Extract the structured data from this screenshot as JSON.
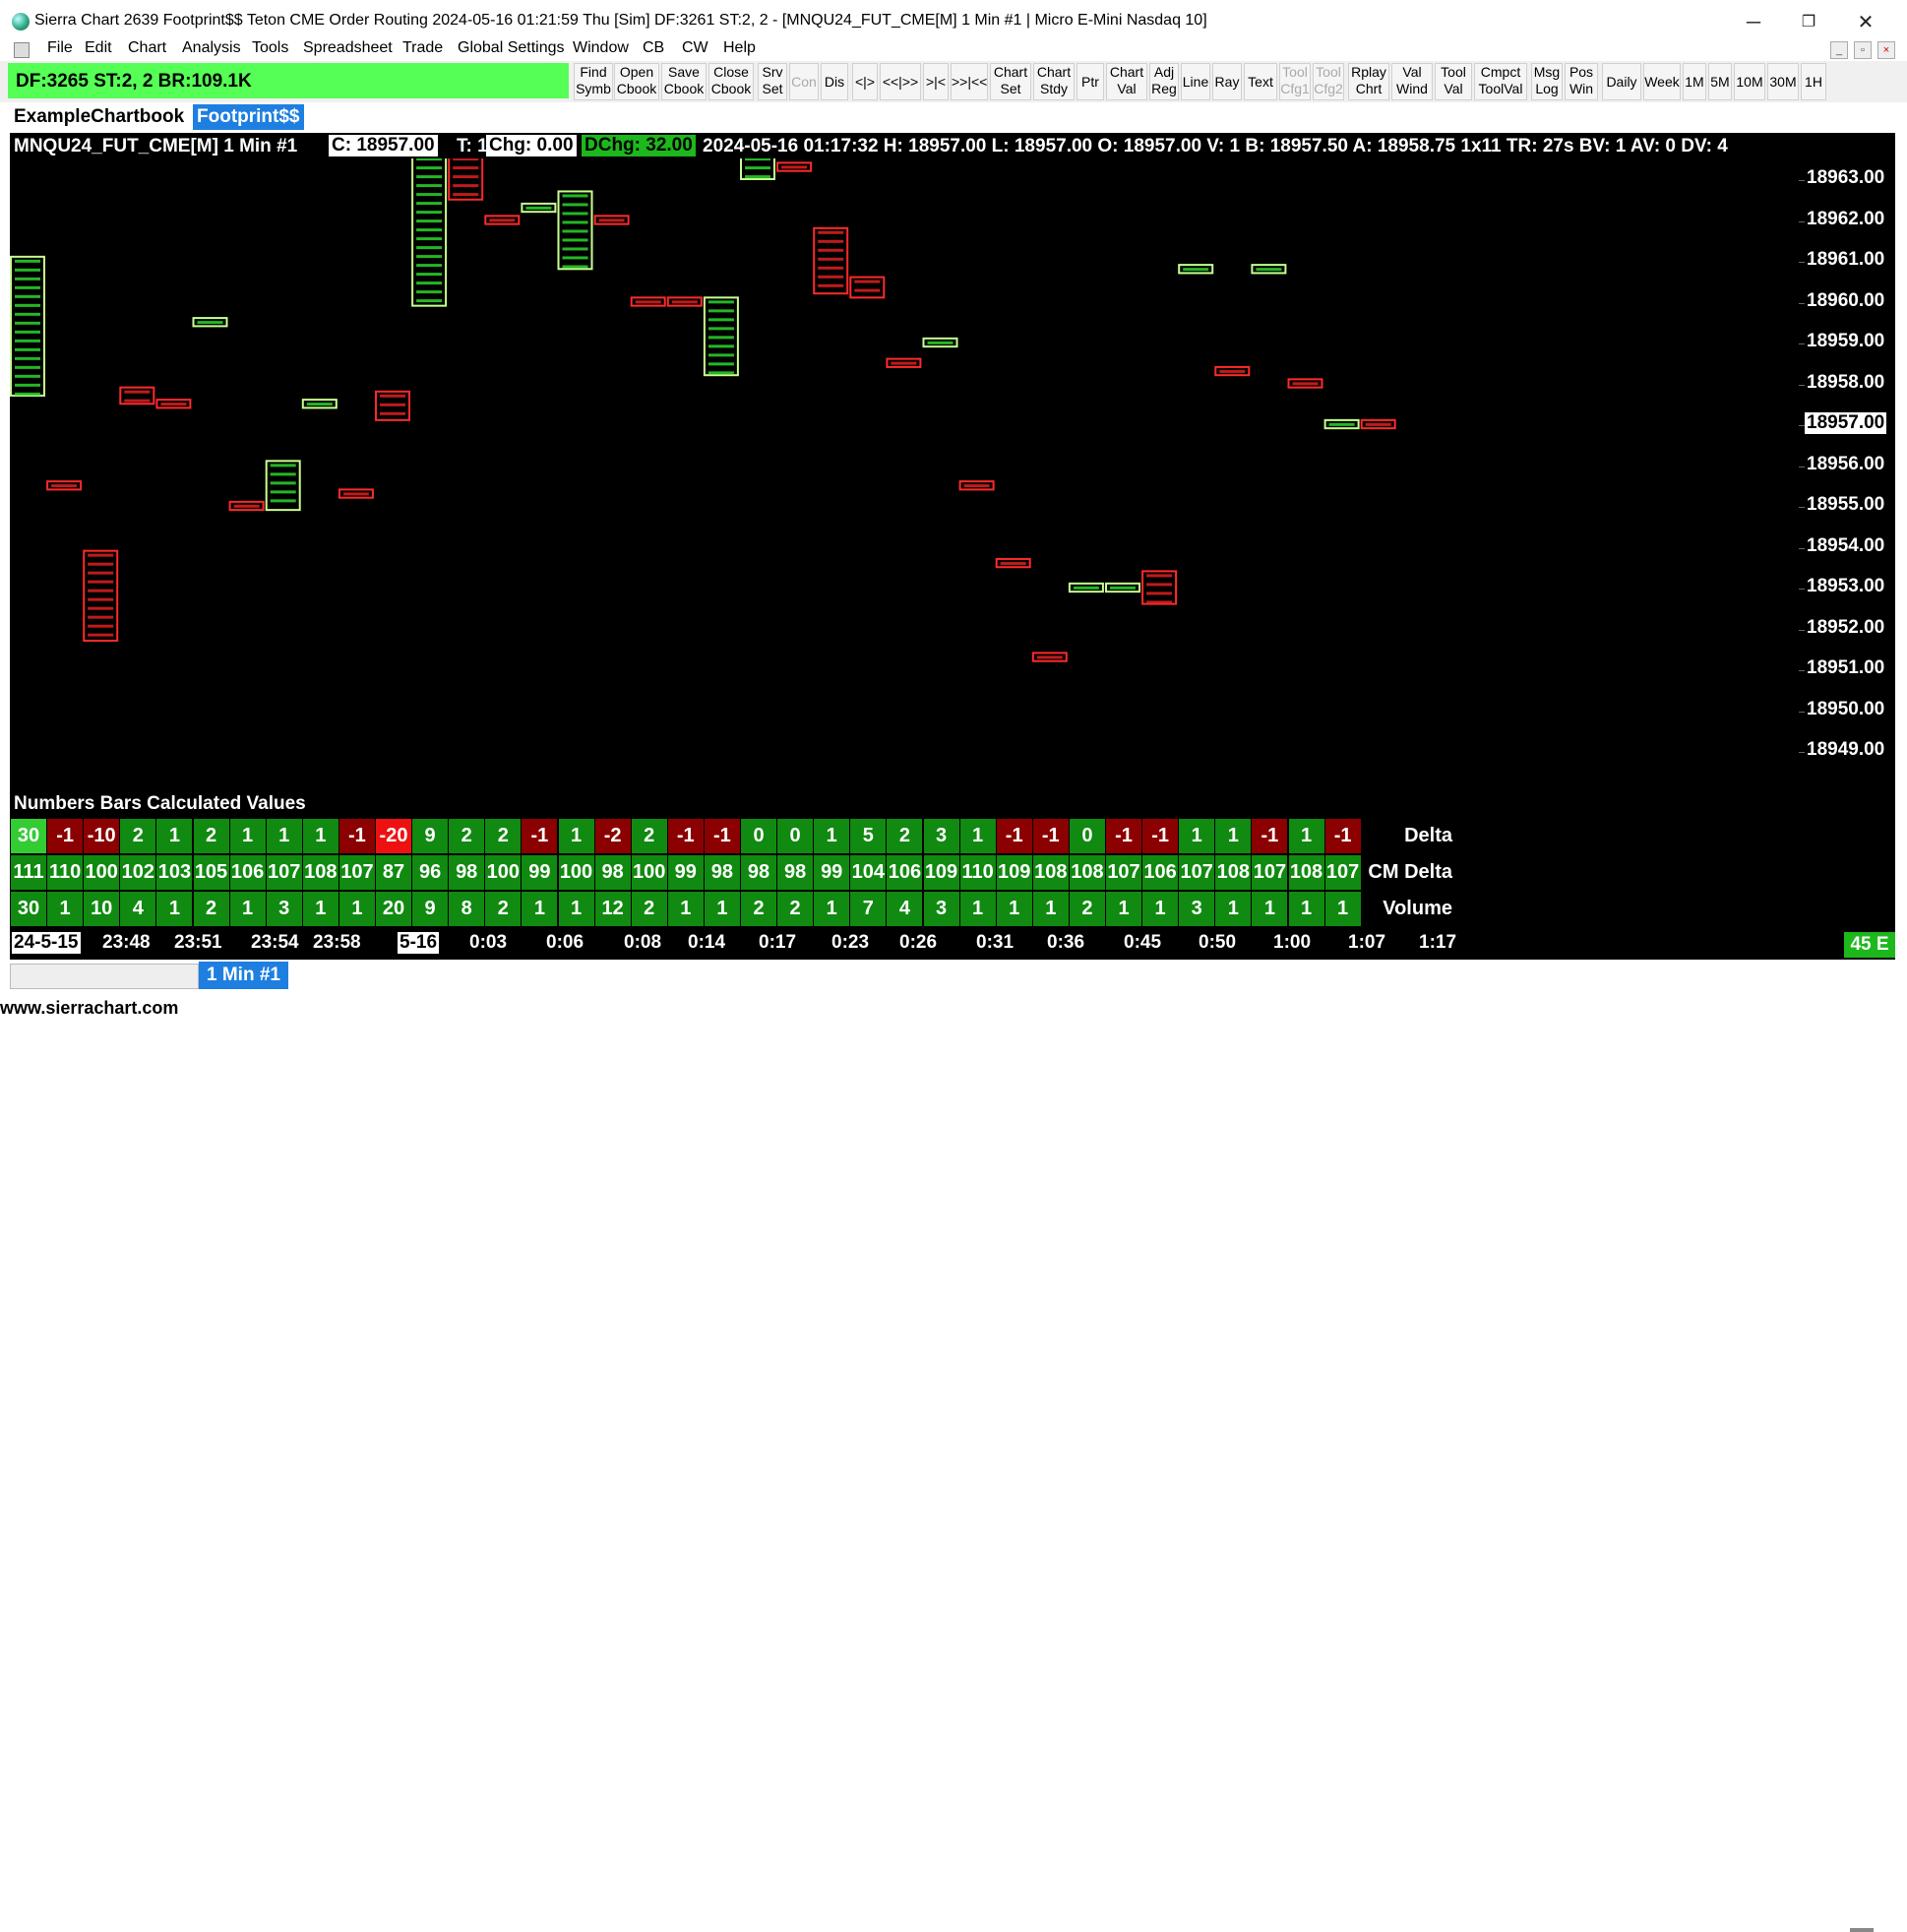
{
  "window": {
    "title": "Sierra Chart 2639 Footprint$$ Teton CME Order Routing 2024-05-16  01:21:59 Thu [Sim] DF:3261  ST:2, 2 - [MNQU24_FUT_CME[M]  1 Min  #1 | Micro E-Mini Nasdaq 10]",
    "minimize": "─",
    "restore": "❐",
    "close": "✕"
  },
  "menu": [
    "File",
    "Edit",
    "Chart",
    "Analysis",
    "Tools",
    "Spreadsheet",
    "Trade",
    "Global Settings",
    "Window",
    "CB",
    "CW",
    "Help"
  ],
  "status": {
    "text": "DF:3265  ST:2, 2  BR:109.1K"
  },
  "toolbar": [
    {
      "l1": "Find",
      "l2": "Symb"
    },
    {
      "l1": "Open",
      "l2": "Cbook"
    },
    {
      "l1": "Save",
      "l2": "Cbook"
    },
    {
      "l1": "Close",
      "l2": "Cbook"
    },
    {
      "l1": "Srv",
      "l2": "Set"
    },
    {
      "l1": "Con",
      "l2": ""
    },
    {
      "l1": "Dis",
      "l2": ""
    },
    {
      "l1": "<|>",
      "l2": ""
    },
    {
      "l1": "<<|>>",
      "l2": ""
    },
    {
      "l1": ">|<",
      "l2": ""
    },
    {
      "l1": ">>|<<",
      "l2": ""
    },
    {
      "l1": "Chart",
      "l2": "Set"
    },
    {
      "l1": "Chart",
      "l2": "Stdy"
    },
    {
      "l1": "Ptr",
      "l2": ""
    },
    {
      "l1": "Chart",
      "l2": "Val"
    },
    {
      "l1": "Adj",
      "l2": "Reg"
    },
    {
      "l1": "Line",
      "l2": ""
    },
    {
      "l1": "Ray",
      "l2": ""
    },
    {
      "l1": "Text",
      "l2": ""
    },
    {
      "l1": "Tool",
      "l2": "Cfg1"
    },
    {
      "l1": "Tool",
      "l2": "Cfg2"
    },
    {
      "l1": "Rplay",
      "l2": "Chrt"
    },
    {
      "l1": "Val",
      "l2": "Wind"
    },
    {
      "l1": "Tool",
      "l2": "Val"
    },
    {
      "l1": "Cmpct",
      "l2": "ToolVal"
    },
    {
      "l1": "Msg",
      "l2": "Log"
    },
    {
      "l1": "Pos",
      "l2": "Win"
    },
    {
      "l1": "Daily",
      "l2": ""
    },
    {
      "l1": "Week",
      "l2": ""
    },
    {
      "l1": "1M",
      "l2": ""
    },
    {
      "l1": "5M",
      "l2": ""
    },
    {
      "l1": "10M",
      "l2": ""
    },
    {
      "l1": "30M",
      "l2": ""
    },
    {
      "l1": "1H",
      "l2": ""
    }
  ],
  "tabs": {
    "chartbook": "ExampleChartbook",
    "active": "Footprint$$"
  },
  "header": {
    "symbol": "MNQU24_FUT_CME[M]  1 Min  #1",
    "close": "C: 18957.00",
    "trades": "T: 1",
    "chg": "Chg: 0.00",
    "dchg": "DChg: 32.00",
    "rest": "2024-05-16 01:17:32 H: 18957.00 L: 18957.00 O: 18957.00 V: 1 B: 18957.50 A: 18958.75 1x11 TR: 27s BV: 1 AV: 0 DV: 4"
  },
  "price_axis": {
    "labels": [
      "18963.00",
      "18962.00",
      "18961.00",
      "18960.00",
      "18959.00",
      "18958.00",
      "18957.00",
      "18956.00",
      "18955.00",
      "18954.00",
      "18953.00",
      "18952.00",
      "18951.00",
      "18950.00",
      "18949.00"
    ],
    "current": "18957.00"
  },
  "chart_data": {
    "type": "candlestick-footprint",
    "bars": [
      {
        "hi": 18961.1,
        "lo": 18957.7,
        "dir": "up"
      },
      {
        "hi": 18955.6,
        "lo": 18955.4,
        "dir": "dn"
      },
      {
        "hi": 18953.9,
        "lo": 18951.7,
        "dir": "dn"
      },
      {
        "hi": 18957.9,
        "lo": 18957.5,
        "dir": "dn"
      },
      {
        "hi": 18957.6,
        "lo": 18957.4,
        "dir": "dn"
      },
      {
        "hi": 18959.6,
        "lo": 18959.4,
        "dir": "up"
      },
      {
        "hi": 18955.1,
        "lo": 18954.9,
        "dir": "dn"
      },
      {
        "hi": 18956.1,
        "lo": 18954.9,
        "dir": "up"
      },
      {
        "hi": 18957.6,
        "lo": 18957.4,
        "dir": "up"
      },
      {
        "hi": 18955.4,
        "lo": 18955.2,
        "dir": "dn"
      },
      {
        "hi": 18957.8,
        "lo": 18957.1,
        "dir": "dn"
      },
      {
        "hi": 18963.6,
        "lo": 18959.9,
        "dir": "up"
      },
      {
        "hi": 18963.6,
        "lo": 18962.5,
        "dir": "dn"
      },
      {
        "hi": 18962.1,
        "lo": 18961.9,
        "dir": "dn"
      },
      {
        "hi": 18962.4,
        "lo": 18962.2,
        "dir": "up"
      },
      {
        "hi": 18962.7,
        "lo": 18960.8,
        "dir": "up"
      },
      {
        "hi": 18962.1,
        "lo": 18961.9,
        "dir": "dn"
      },
      {
        "hi": 18960.1,
        "lo": 18959.9,
        "dir": "dn"
      },
      {
        "hi": 18960.1,
        "lo": 18959.9,
        "dir": "dn"
      },
      {
        "hi": 18960.1,
        "lo": 18958.2,
        "dir": "up"
      },
      {
        "hi": 18963.6,
        "lo": 18963.0,
        "dir": "up"
      },
      {
        "hi": 18963.4,
        "lo": 18963.2,
        "dir": "dn"
      },
      {
        "hi": 18961.8,
        "lo": 18960.2,
        "dir": "dn"
      },
      {
        "hi": 18960.6,
        "lo": 18960.1,
        "dir": "dn"
      },
      {
        "hi": 18958.6,
        "lo": 18958.4,
        "dir": "dn"
      },
      {
        "hi": 18959.1,
        "lo": 18958.9,
        "dir": "up"
      },
      {
        "hi": 18955.6,
        "lo": 18955.4,
        "dir": "dn"
      },
      {
        "hi": 18953.7,
        "lo": 18953.5,
        "dir": "dn"
      },
      {
        "hi": 18951.4,
        "lo": 18951.2,
        "dir": "dn"
      },
      {
        "hi": 18953.1,
        "lo": 18952.9,
        "dir": "up"
      },
      {
        "hi": 18953.1,
        "lo": 18952.9,
        "dir": "up"
      },
      {
        "hi": 18953.4,
        "lo": 18952.6,
        "dir": "dn"
      },
      {
        "hi": 18960.9,
        "lo": 18960.7,
        "dir": "up"
      },
      {
        "hi": 18958.4,
        "lo": 18958.2,
        "dir": "dn"
      },
      {
        "hi": 18960.9,
        "lo": 18960.7,
        "dir": "up"
      },
      {
        "hi": 18958.1,
        "lo": 18957.9,
        "dir": "dn"
      },
      {
        "hi": 18957.1,
        "lo": 18956.9,
        "dir": "up"
      },
      {
        "hi": 18957.1,
        "lo": 18956.9,
        "dir": "dn"
      }
    ]
  },
  "numbers_bars": {
    "title": "Numbers Bars Calculated Values",
    "rows": [
      {
        "label": "Delta",
        "values": [
          "30",
          "-1",
          "-10",
          "2",
          "1",
          "2",
          "1",
          "1",
          "1",
          "-1",
          "-20",
          "9",
          "2",
          "2",
          "-1",
          "1",
          "-2",
          "2",
          "-1",
          "-1",
          "0",
          "0",
          "1",
          "5",
          "2",
          "3",
          "1",
          "-1",
          "-1",
          "0",
          "-1",
          "-1",
          "1",
          "1",
          "-1",
          "1",
          "-1"
        ],
        "colors": [
          "bg",
          "r",
          "r",
          "g",
          "g",
          "g",
          "g",
          "g",
          "g",
          "r",
          "br",
          "g",
          "g",
          "g",
          "r",
          "g",
          "r",
          "g",
          "r",
          "r",
          "g",
          "g",
          "g",
          "g",
          "g",
          "g",
          "g",
          "r",
          "r",
          "g",
          "r",
          "r",
          "g",
          "g",
          "r",
          "g",
          "r"
        ]
      },
      {
        "label": "CM Delta",
        "values": [
          "111",
          "110",
          "100",
          "102",
          "103",
          "105",
          "106",
          "107",
          "108",
          "107",
          "87",
          "96",
          "98",
          "100",
          "99",
          "100",
          "98",
          "100",
          "99",
          "98",
          "98",
          "98",
          "99",
          "104",
          "106",
          "109",
          "110",
          "109",
          "108",
          "108",
          "107",
          "106",
          "107",
          "108",
          "107",
          "108",
          "107"
        ]
      },
      {
        "label": "Volume",
        "values": [
          "30",
          "1",
          "10",
          "4",
          "1",
          "2",
          "1",
          "3",
          "1",
          "1",
          "20",
          "9",
          "8",
          "2",
          "1",
          "1",
          "12",
          "2",
          "1",
          "1",
          "2",
          "2",
          "1",
          "7",
          "4",
          "3",
          "1",
          "1",
          "1",
          "2",
          "1",
          "1",
          "3",
          "1",
          "1",
          "1",
          "1"
        ]
      }
    ]
  },
  "xaxis": {
    "labels": [
      {
        "t": "24-5-15",
        "box": true
      },
      {
        "t": "23:48",
        "box": false
      },
      {
        "t": "23:51",
        "box": false
      },
      {
        "t": "23:54",
        "box": false
      },
      {
        "t": "23:58",
        "box": false
      },
      {
        "t": "5-16",
        "box": true
      },
      {
        "t": "0:03",
        "box": false
      },
      {
        "t": "0:06",
        "box": false
      },
      {
        "t": "0:08",
        "box": false
      },
      {
        "t": "0:14",
        "box": false
      },
      {
        "t": "0:17",
        "box": false
      },
      {
        "t": "0:23",
        "box": false
      },
      {
        "t": "0:26",
        "box": false
      },
      {
        "t": "0:31",
        "box": false
      },
      {
        "t": "0:36",
        "box": false
      },
      {
        "t": "0:45",
        "box": false
      },
      {
        "t": "0:50",
        "box": false
      },
      {
        "t": "1:00",
        "box": false
      },
      {
        "t": "1:07",
        "box": false
      },
      {
        "t": "1:17",
        "box": false
      }
    ]
  },
  "badge": "45 E",
  "bottom_tab": "1 Min  #1",
  "site": "www.sierrachart.com"
}
